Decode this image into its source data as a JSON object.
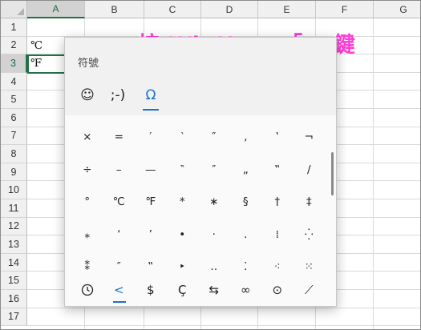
{
  "spreadsheet": {
    "columns": [
      "A",
      "B",
      "C",
      "D",
      "E",
      "F",
      "G"
    ],
    "rows": [
      "1",
      "2",
      "3",
      "4",
      "5",
      "6",
      "7",
      "8",
      "9",
      "10",
      "11",
      "12",
      "13",
      "14",
      "15",
      "16",
      "17"
    ],
    "active_column": "A",
    "active_row": "3",
    "cells": {
      "A2": "℃",
      "A3": "℉"
    }
  },
  "annotation": {
    "text": "按 WinKey+「.」鍵",
    "color": "#ff3fd8"
  },
  "symbol_panel": {
    "title": "符號",
    "tabs": [
      {
        "label": "☺",
        "icon": "smiley-icon"
      },
      {
        "label": ";-)",
        "icon": "kaomoji-icon"
      },
      {
        "label": "Ω",
        "icon": "symbols-icon"
      }
    ],
    "active_tab": 2,
    "accent_color": "#1a73c8",
    "symbols": [
      "×",
      "=",
      "′",
      "‵",
      "″",
      "‚",
      "‛",
      "¬",
      "÷",
      "–",
      "—",
      "‶",
      "″",
      "„",
      "‟",
      "∕",
      "°",
      "℃",
      "℉",
      "*",
      "∗",
      "§",
      "†",
      "‡",
      "⁎",
      "‘",
      "’",
      "•",
      "·",
      ".",
      "⁞",
      "⁛",
      "⁑",
      "″",
      "‟",
      "‣",
      "‥",
      "⁚",
      "⁖",
      "⁙"
    ],
    "bottom_categories": [
      {
        "label": "🕒",
        "icon": "recent-clock-icon"
      },
      {
        "label": "<",
        "icon": "punctuation-icon"
      },
      {
        "label": "$",
        "icon": "currency-icon"
      },
      {
        "label": "Ç",
        "icon": "latin-icon"
      },
      {
        "label": "⇆",
        "icon": "arrows-icon"
      },
      {
        "label": "∞",
        "icon": "math-icon"
      },
      {
        "label": "⊙",
        "icon": "geometric-icon"
      },
      {
        "label": "⟋",
        "icon": "language-icon"
      }
    ],
    "active_bottom": 1
  }
}
